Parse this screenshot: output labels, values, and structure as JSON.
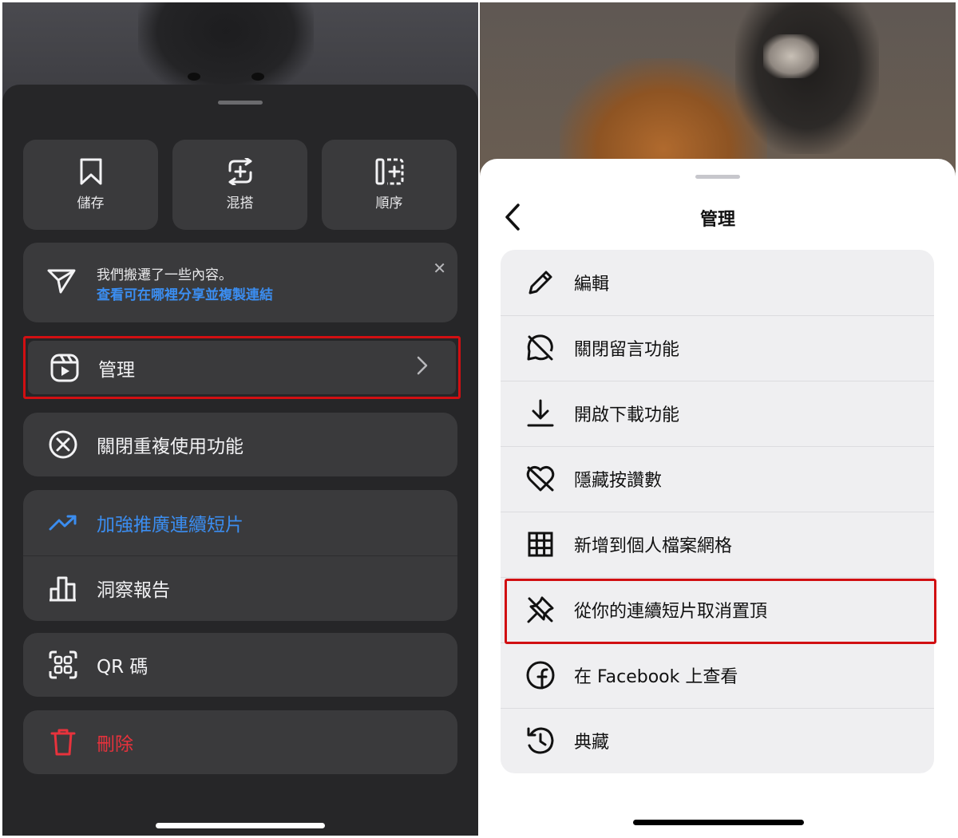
{
  "left_panel": {
    "quick_actions": [
      {
        "label": "儲存",
        "icon": "bookmark-icon"
      },
      {
        "label": "混搭",
        "icon": "remix-icon"
      },
      {
        "label": "順序",
        "icon": "sequence-icon"
      }
    ],
    "notice": {
      "line1": "我們搬遷了一些內容。",
      "link": "查看可在哪裡分享並複製連結",
      "close": "✕",
      "link_color": "#3b8df0"
    },
    "manage_label": "管理",
    "disable_reuse_label": "關閉重複使用功能",
    "boost_label": "加強推廣連續短片",
    "insights_label": "洞察報告",
    "qr_label": "QR 碼",
    "delete_label": "刪除",
    "colors": {
      "background": "#262628",
      "card": "#3a3a3c",
      "accent": "#3b8df0",
      "danger": "#e8323c",
      "highlight": "#d10f12"
    }
  },
  "right_panel": {
    "title": "管理",
    "items": [
      {
        "label": "編輯",
        "icon": "pencil-icon"
      },
      {
        "label": "關閉留言功能",
        "icon": "comments-off-icon"
      },
      {
        "label": "開啟下載功能",
        "icon": "download-icon"
      },
      {
        "label": "隱藏按讚數",
        "icon": "heart-off-icon"
      },
      {
        "label": "新增到個人檔案網格",
        "icon": "grid-icon"
      },
      {
        "label": "從你的連續短片取消置頂",
        "icon": "unpin-icon"
      },
      {
        "label": "在 Facebook 上查看",
        "icon": "facebook-icon"
      },
      {
        "label": "典藏",
        "icon": "archive-icon"
      }
    ],
    "colors": {
      "background": "#ffffff",
      "card": "#efeff1",
      "highlight": "#d10f12"
    }
  }
}
